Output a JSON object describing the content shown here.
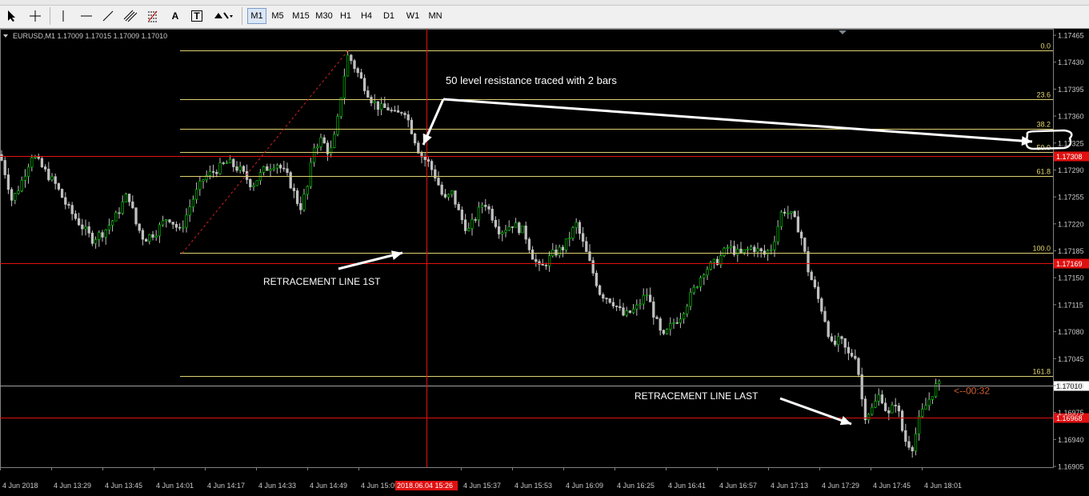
{
  "toolbar": {
    "tools": [
      {
        "name": "cursor-tool",
        "label": ""
      },
      {
        "name": "crosshair-tool",
        "label": ""
      },
      {
        "name": "vertical-line-tool",
        "label": ""
      },
      {
        "name": "horizontal-line-tool",
        "label": ""
      },
      {
        "name": "trendline-tool",
        "label": ""
      },
      {
        "name": "equidistant-channel-tool",
        "label": ""
      },
      {
        "name": "fibonacci-retracement-tool",
        "label": ""
      },
      {
        "name": "text-tool",
        "label": "A"
      },
      {
        "name": "text-label-tool",
        "label": "T"
      },
      {
        "name": "arrows-tool",
        "label": ""
      }
    ],
    "timeframes": [
      "M1",
      "M5",
      "M15",
      "M30",
      "H1",
      "H4",
      "D1",
      "W1",
      "MN"
    ],
    "active_timeframe": "M1"
  },
  "chart_data": {
    "type": "candlestick",
    "symbol_info": "EURUSD,M1  1.17009 1.17015 1.17009 1.17010",
    "ylim": [
      1.16905,
      1.17465
    ],
    "price_ticks": [
      "1.17465",
      "1.17430",
      "1.17395",
      "1.17360",
      "1.17325",
      "1.17290",
      "1.17255",
      "1.17220",
      "1.17185",
      "1.17150",
      "1.17115",
      "1.17080",
      "1.17045",
      "1.17010",
      "1.16975",
      "1.16940",
      "1.16905"
    ],
    "time_ticks": [
      "4 Jun 2018",
      "4 Jun 13:29",
      "4 Jun 13:45",
      "4 Jun 14:01",
      "4 Jun 14:17",
      "4 Jun 14:33",
      "4 Jun 14:49",
      "4 Jun 15:05",
      "4 Jun 15:37",
      "4 Jun 15:53",
      "4 Jun 16:09",
      "4 Jun 16:25",
      "4 Jun 16:41",
      "4 Jun 16:57",
      "4 Jun 17:13",
      "4 Jun 17:29",
      "4 Jun 17:45",
      "4 Jun 18:01"
    ],
    "crosshair_time_label": "2018.06.04 15:26",
    "current_price": "1.17010",
    "countdown": "<--00:32",
    "fib_levels": [
      {
        "label": "0.0",
        "price": 1.17445
      },
      {
        "label": "23.6",
        "price": 1.17382
      },
      {
        "label": "38.2",
        "price": 1.17343
      },
      {
        "label": "50.0",
        "price": 1.17313
      },
      {
        "label": "61.8",
        "price": 1.17282
      },
      {
        "label": "100.0",
        "price": 1.17182
      },
      {
        "label": "161.8",
        "price": 1.17022
      }
    ],
    "red_lines": [
      {
        "label": "1.17308",
        "price": 1.17308
      },
      {
        "label": "1.17169",
        "price": 1.17169
      },
      {
        "label": "1.16968",
        "price": 1.16968
      }
    ],
    "annotations": [
      "50 level resistance traced with 2 bars",
      "RETRACEMENT LINE 1ST",
      "RETRACEMENT LINE LAST"
    ],
    "ohlc_path": [
      [
        0,
        1.1731
      ],
      [
        8,
        1.1728
      ],
      [
        15,
        1.1725
      ],
      [
        25,
        1.1727
      ],
      [
        40,
        1.1731
      ],
      [
        55,
        1.1729
      ],
      [
        70,
        1.1727
      ],
      [
        85,
        1.1724
      ],
      [
        100,
        1.1722
      ],
      [
        115,
        1.172
      ],
      [
        130,
        1.1721
      ],
      [
        145,
        1.1723
      ],
      [
        160,
        1.1726
      ],
      [
        170,
        1.1722
      ],
      [
        180,
        1.172
      ],
      [
        195,
        1.1721
      ],
      [
        210,
        1.1723
      ],
      [
        225,
        1.1721
      ],
      [
        240,
        1.1725
      ],
      [
        255,
        1.1728
      ],
      [
        270,
        1.1729
      ],
      [
        285,
        1.173
      ],
      [
        300,
        1.1729
      ],
      [
        315,
        1.1727
      ],
      [
        330,
        1.1729
      ],
      [
        345,
        1.173
      ],
      [
        360,
        1.1728
      ],
      [
        375,
        1.1724
      ],
      [
        385,
        1.1727
      ],
      [
        392,
        1.1732
      ],
      [
        402,
        1.1733
      ],
      [
        412,
        1.1731
      ],
      [
        420,
        1.1734
      ],
      [
        428,
        1.174
      ],
      [
        435,
        1.1744
      ],
      [
        445,
        1.1742
      ],
      [
        455,
        1.174
      ],
      [
        465,
        1.1738
      ],
      [
        475,
        1.1737
      ],
      [
        485,
        1.1737
      ],
      [
        495,
        1.1736
      ],
      [
        505,
        1.1737
      ],
      [
        515,
        1.1734
      ],
      [
        525,
        1.1731
      ],
      [
        535,
        1.173
      ],
      [
        545,
        1.1728
      ],
      [
        555,
        1.1725
      ],
      [
        565,
        1.1726
      ],
      [
        575,
        1.1723
      ],
      [
        585,
        1.1721
      ],
      [
        595,
        1.1723
      ],
      [
        605,
        1.1725
      ],
      [
        615,
        1.1723
      ],
      [
        625,
        1.1721
      ],
      [
        640,
        1.1722
      ],
      [
        655,
        1.1721
      ],
      [
        665,
        1.1718
      ],
      [
        675,
        1.1716
      ],
      [
        690,
        1.1718
      ],
      [
        705,
        1.1719
      ],
      [
        720,
        1.1722
      ],
      [
        730,
        1.1719
      ],
      [
        740,
        1.1716
      ],
      [
        750,
        1.1713
      ],
      [
        765,
        1.1712
      ],
      [
        780,
        1.171
      ],
      [
        795,
        1.1711
      ],
      [
        808,
        1.1713
      ],
      [
        818,
        1.171
      ],
      [
        828,
        1.1707
      ],
      [
        840,
        1.1709
      ],
      [
        850,
        1.171
      ],
      [
        860,
        1.1712
      ],
      [
        870,
        1.1714
      ],
      [
        880,
        1.1716
      ],
      [
        895,
        1.1717
      ],
      [
        910,
        1.1719
      ],
      [
        925,
        1.1718
      ],
      [
        940,
        1.1719
      ],
      [
        955,
        1.1718
      ],
      [
        965,
        1.1719
      ],
      [
        978,
        1.1724
      ],
      [
        990,
        1.1723
      ],
      [
        1000,
        1.1721
      ],
      [
        1010,
        1.1716
      ],
      [
        1020,
        1.1713
      ],
      [
        1030,
        1.171
      ],
      [
        1040,
        1.1706
      ],
      [
        1050,
        1.1707
      ],
      [
        1060,
        1.1705
      ],
      [
        1070,
        1.1705
      ],
      [
        1080,
        1.1697
      ],
      [
        1090,
        1.1698
      ],
      [
        1100,
        1.17
      ],
      [
        1110,
        1.1697
      ],
      [
        1120,
        1.1699
      ],
      [
        1130,
        1.1694
      ],
      [
        1140,
        1.1693
      ],
      [
        1150,
        1.1697
      ],
      [
        1160,
        1.1699
      ],
      [
        1170,
        1.1701
      ],
      [
        1175,
        1.1701
      ]
    ]
  }
}
